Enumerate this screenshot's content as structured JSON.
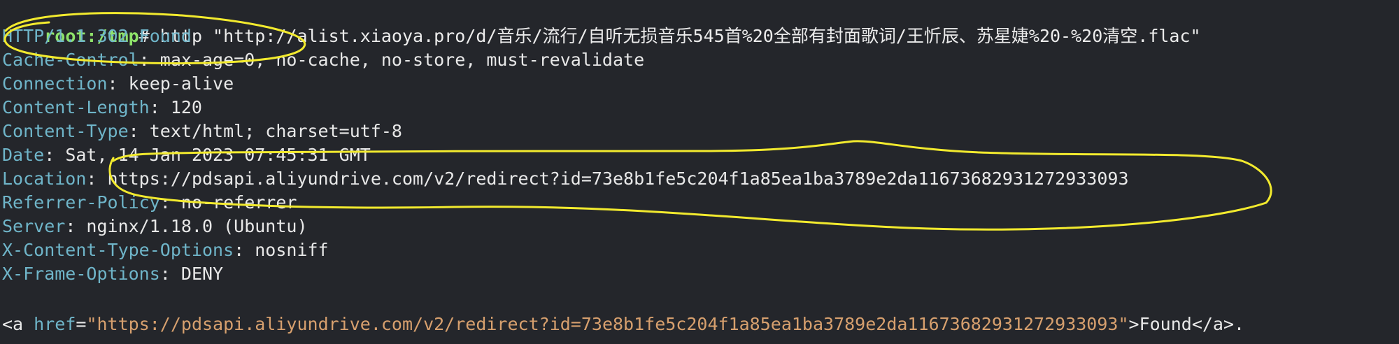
{
  "prompt": {
    "user_host": "root:/tmp",
    "symbol": "#",
    "command": " http \"http://alist.xiaoya.pro/d/音乐/流行/自听无损音乐545首%20全部有封面歌词/王忻辰、苏星婕%20-%20清空.flac\""
  },
  "response": {
    "status_line": "HTTP/1.1 302 Found",
    "headers": [
      {
        "key": "Cache-Control",
        "value": "max-age=0, no-cache, no-store, must-revalidate"
      },
      {
        "key": "Connection",
        "value": "keep-alive"
      },
      {
        "key": "Content-Length",
        "value": "120"
      },
      {
        "key": "Content-Type",
        "value": "text/html; charset=utf-8"
      },
      {
        "key": "Date",
        "value": "Sat, 14 Jan 2023 07:45:31 GMT"
      },
      {
        "key": "Location",
        "value": "https://pdsapi.aliyundrive.com/v2/redirect?id=73e8b1fe5c204f1a85ea1ba3789e2da11673682931272933093"
      },
      {
        "key": "Referrer-Policy",
        "value": "no-referrer"
      },
      {
        "key": "Server",
        "value": "nginx/1.18.0 (Ubuntu)"
      },
      {
        "key": "X-Content-Type-Options",
        "value": "nosniff"
      },
      {
        "key": "X-Frame-Options",
        "value": "DENY"
      }
    ],
    "body": {
      "tag_open": "<a",
      "attr_name": " href",
      "equals": "=",
      "attr_value": "\"https://pdsapi.aliyundrive.com/v2/redirect?id=73e8b1fe5c204f1a85ea1ba3789e2da11673682931272933093\"",
      "link_text": ">Found</a>."
    }
  },
  "colors": {
    "background": "#24262b",
    "prompt": "#8fe36a",
    "header_key": "#6fb5c9",
    "string_value": "#d7a06e",
    "annotation": "#f2ea2e"
  }
}
